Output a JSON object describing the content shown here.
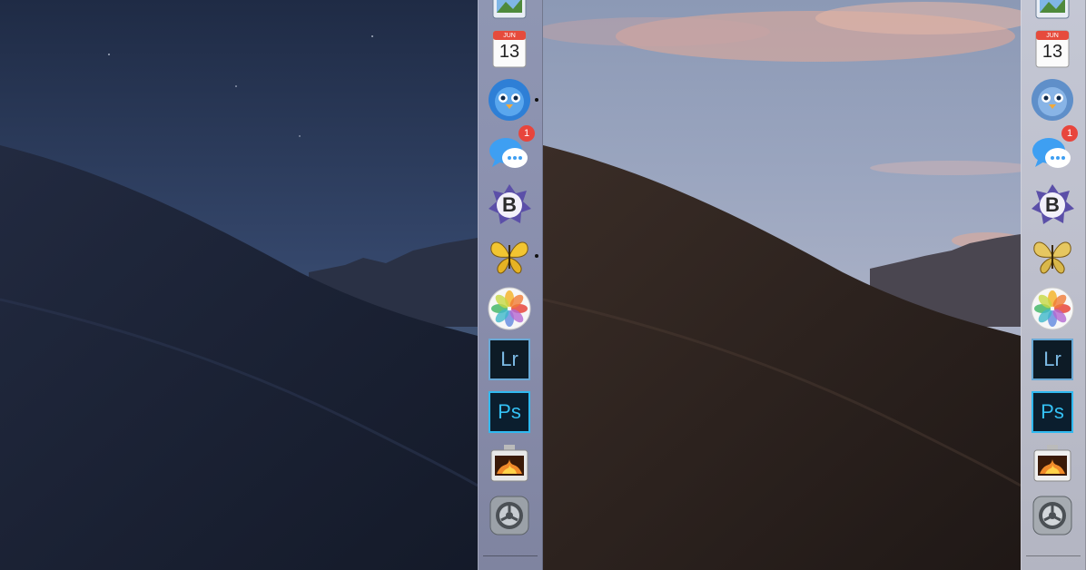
{
  "left_side": {
    "appearance": "dark",
    "dock": {
      "items": [
        {
          "name": "Preview",
          "icon": "preview-icon",
          "running": false
        },
        {
          "name": "Calendar",
          "icon": "calendar-icon",
          "month": "JUN",
          "day": "13",
          "running": false
        },
        {
          "name": "Tweetbot",
          "icon": "tweetbot-bird-icon",
          "running": true
        },
        {
          "name": "Messages",
          "icon": "messages-bubble-icon",
          "badge": "1",
          "running": false
        },
        {
          "name": "BBEdit",
          "icon": "bbedit-icon",
          "letter": "B",
          "running": false
        },
        {
          "name": "Tes",
          "icon": "butterfly-icon",
          "running": true
        },
        {
          "name": "Photos",
          "icon": "photos-flower-icon",
          "running": false
        },
        {
          "name": "Lightroom",
          "icon": "lightroom-icon",
          "label": "Lr",
          "running": false
        },
        {
          "name": "Photoshop",
          "icon": "photoshop-icon",
          "label": "Ps",
          "running": false
        },
        {
          "name": "Photo Booth",
          "icon": "photo-booth-icon",
          "running": false
        },
        {
          "name": "System Preferences",
          "icon": "gear-icon",
          "running": false
        }
      ]
    }
  },
  "right_side": {
    "appearance": "light",
    "dock": {
      "items": [
        {
          "name": "Preview",
          "icon": "preview-icon"
        },
        {
          "name": "Calendar",
          "icon": "calendar-icon",
          "month": "JUN",
          "day": "13"
        },
        {
          "name": "Tweetbot",
          "icon": "tweetbot-bird-icon"
        },
        {
          "name": "Messages",
          "icon": "messages-bubble-icon",
          "badge": "1"
        },
        {
          "name": "BBEdit",
          "icon": "bbedit-icon",
          "letter": "B"
        },
        {
          "name": "Tes",
          "icon": "butterfly-icon"
        },
        {
          "name": "Photos",
          "icon": "photos-flower-icon"
        },
        {
          "name": "Lightroom",
          "icon": "lightroom-icon",
          "label": "Lr"
        },
        {
          "name": "Photoshop",
          "icon": "photoshop-icon",
          "label": "Ps"
        },
        {
          "name": "Photo Booth",
          "icon": "photo-booth-icon"
        },
        {
          "name": "System Preferences",
          "icon": "gear-icon"
        }
      ]
    }
  },
  "colors": {
    "night_sky_top": "#1f2b45",
    "night_sky_horizon": "#4b5f7e",
    "night_dune": "#1c2233",
    "day_sky_top": "#8c99b5",
    "day_cloud": "#d9a89b",
    "day_dune": "#2a211e",
    "badge_red": "#e8453c",
    "adobe_blue": "#30b9f0"
  }
}
